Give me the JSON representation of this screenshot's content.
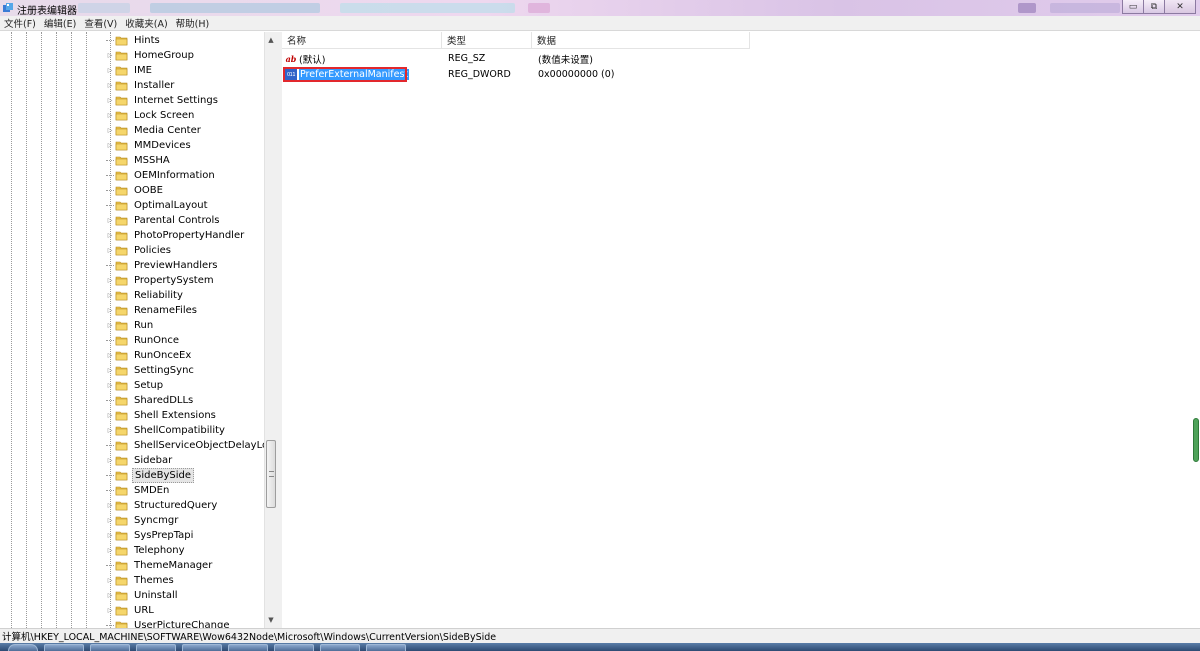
{
  "window": {
    "title": "注册表编辑器",
    "minimize_icon": "minimize-icon",
    "maximize_icon": "restore-icon",
    "close_icon": "close-icon"
  },
  "menu": [
    "文件(F)",
    "编辑(E)",
    "查看(V)",
    "收藏夹(A)",
    "帮助(H)"
  ],
  "tree": {
    "items": [
      {
        "label": "Hints",
        "expandable": false
      },
      {
        "label": "HomeGroup",
        "expandable": true
      },
      {
        "label": "IME",
        "expandable": true
      },
      {
        "label": "Installer",
        "expandable": true
      },
      {
        "label": "Internet Settings",
        "expandable": true
      },
      {
        "label": "Lock Screen",
        "expandable": true
      },
      {
        "label": "Media Center",
        "expandable": true
      },
      {
        "label": "MMDevices",
        "expandable": true
      },
      {
        "label": "MSSHA",
        "expandable": false
      },
      {
        "label": "OEMInformation",
        "expandable": false
      },
      {
        "label": "OOBE",
        "expandable": false
      },
      {
        "label": "OptimalLayout",
        "expandable": false
      },
      {
        "label": "Parental Controls",
        "expandable": true
      },
      {
        "label": "PhotoPropertyHandler",
        "expandable": true
      },
      {
        "label": "Policies",
        "expandable": true
      },
      {
        "label": "PreviewHandlers",
        "expandable": false
      },
      {
        "label": "PropertySystem",
        "expandable": true
      },
      {
        "label": "Reliability",
        "expandable": true
      },
      {
        "label": "RenameFiles",
        "expandable": true
      },
      {
        "label": "Run",
        "expandable": true
      },
      {
        "label": "RunOnce",
        "expandable": false
      },
      {
        "label": "RunOnceEx",
        "expandable": true
      },
      {
        "label": "SettingSync",
        "expandable": true
      },
      {
        "label": "Setup",
        "expandable": true
      },
      {
        "label": "SharedDLLs",
        "expandable": false
      },
      {
        "label": "Shell Extensions",
        "expandable": true
      },
      {
        "label": "ShellCompatibility",
        "expandable": true
      },
      {
        "label": "ShellServiceObjectDelayLoad",
        "expandable": false
      },
      {
        "label": "Sidebar",
        "expandable": true
      },
      {
        "label": "SideBySide",
        "expandable": false,
        "selected": true
      },
      {
        "label": "SMDEn",
        "expandable": false
      },
      {
        "label": "StructuredQuery",
        "expandable": true
      },
      {
        "label": "Syncmgr",
        "expandable": true
      },
      {
        "label": "SysPrepTapi",
        "expandable": true
      },
      {
        "label": "Telephony",
        "expandable": true
      },
      {
        "label": "ThemeManager",
        "expandable": false
      },
      {
        "label": "Themes",
        "expandable": true
      },
      {
        "label": "Uninstall",
        "expandable": true
      },
      {
        "label": "URL",
        "expandable": true
      },
      {
        "label": "UserPictureChange",
        "expandable": false
      }
    ]
  },
  "values": {
    "headers": {
      "name": "名称",
      "type": "类型",
      "data": "数据"
    },
    "rows": [
      {
        "icon": "ab",
        "icon_name": "string-value-icon",
        "name": "(默认)",
        "type": "REG_SZ",
        "data": "(数值未设置)"
      },
      {
        "icon": "011",
        "icon_name": "dword-value-icon",
        "name": "PreferExternalManifest",
        "type": "REG_DWORD",
        "data": "0x00000000 (0)",
        "selected": true
      }
    ]
  },
  "status_path": "计算机\\HKEY_LOCAL_MACHINE\\SOFTWARE\\Wow6432Node\\Microsoft\\Windows\\CurrentVersion\\SideBySide",
  "colors": {
    "selection": "#3399ff",
    "highlight_box": "#e2282d",
    "folder": "#e8c14a"
  }
}
